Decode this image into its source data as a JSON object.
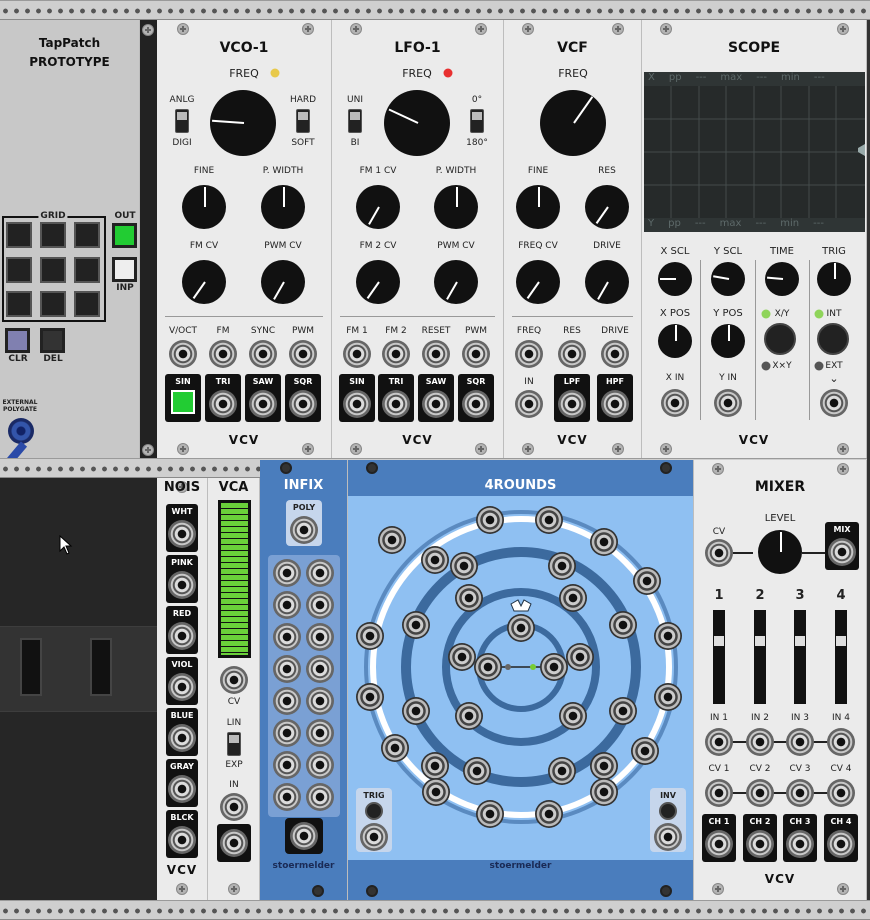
{
  "tappatch": {
    "title": "TapPatch",
    "subtitle": "PROTOTYPE",
    "grid_label": "GRID",
    "out_label": "OUT",
    "inp_label": "INP",
    "clr_label": "CLR",
    "del_label": "DEL",
    "ext_line1": "EXTERNAL",
    "ext_line2": "POLYGATE",
    "out_color": "#22cc33"
  },
  "vco": {
    "title": "VCO-1",
    "freq": "FREQ",
    "anlg": "ANLG",
    "digi": "DIGI",
    "hard": "HARD",
    "soft": "SOFT",
    "fine": "FINE",
    "pwidth": "P. WIDTH",
    "fmcv": "FM CV",
    "pwmcv": "PWM CV",
    "voct": "V/OCT",
    "fm": "FM",
    "sync": "SYNC",
    "pwm": "PWM",
    "sin": "SIN",
    "tri": "TRI",
    "saw": "SAW",
    "sqr": "SQR",
    "led_color": "#e8c94a"
  },
  "lfo": {
    "title": "LFO-1",
    "freq": "FREQ",
    "uni": "UNI",
    "bi": "BI",
    "deg0": "0°",
    "deg180": "180°",
    "fm1cv": "FM 1 CV",
    "pwidth": "P. WIDTH",
    "fm2cv": "FM 2 CV",
    "pwmcv": "PWM CV",
    "fm1": "FM 1",
    "fm2": "FM 2",
    "reset": "RESET",
    "pwm": "PWM",
    "sin": "SIN",
    "tri": "TRI",
    "saw": "SAW",
    "sqr": "SQR",
    "led_color": "#e83030"
  },
  "vcf": {
    "title": "VCF",
    "freq": "FREQ",
    "fine": "FINE",
    "res": "RES",
    "freqcv": "FREQ CV",
    "drive": "DRIVE",
    "in_freq": "FREQ",
    "in_res": "RES",
    "in_drive": "DRIVE",
    "in": "IN",
    "lpf": "LPF",
    "hpf": "HPF"
  },
  "scope": {
    "title": "SCOPE",
    "top_readout": [
      "X",
      "pp",
      "---",
      "max",
      "---",
      "min",
      "---"
    ],
    "bottom_readout": [
      "Y",
      "pp",
      "---",
      "max",
      "---",
      "min",
      "---"
    ],
    "xscl": "X SCL",
    "yscl": "Y SCL",
    "time": "TIME",
    "trig": "TRIG",
    "xpos": "X POS",
    "ypos": "Y POS",
    "xy": "X/Y",
    "xxy": "X×Y",
    "int": "INT",
    "ext": "EXT",
    "xin": "X IN",
    "yin": "Y IN"
  },
  "nois": {
    "title": "NOIS",
    "items": [
      "WHT",
      "PINK",
      "RED",
      "VIOL",
      "BLUE",
      "GRAY",
      "BLCK"
    ]
  },
  "vca": {
    "title": "VCA",
    "cv": "CV",
    "lin": "LIN",
    "exp": "EXP",
    "in": "IN",
    "level": 1.0
  },
  "infix": {
    "title": "INFIX",
    "poly": "POLY",
    "brand": "stoermelder"
  },
  "rounds": {
    "title": "4ROUNDS",
    "trig": "TRIG",
    "inv": "INV",
    "brand": "stoermelder"
  },
  "mixer": {
    "title": "MIXER",
    "cv": "CV",
    "level": "LEVEL",
    "mix": "MIX",
    "channels": [
      "1",
      "2",
      "3",
      "4"
    ],
    "ins": [
      "IN 1",
      "IN 2",
      "IN 3",
      "IN 4"
    ],
    "cvs": [
      "CV 1",
      "CV 2",
      "CV 3",
      "CV 4"
    ],
    "outs": [
      "CH 1",
      "CH 2",
      "CH 3",
      "CH 4"
    ]
  },
  "brand": "VCV"
}
